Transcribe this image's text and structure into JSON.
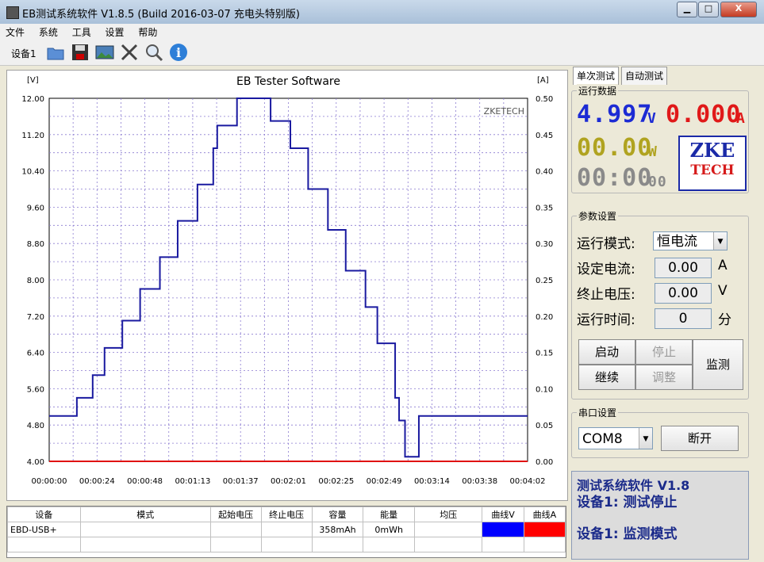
{
  "window": {
    "title": "EB测试系统软件 V1.8.5 (Build 2016-03-07 充电头特别版)",
    "min_label": "▁",
    "max_label": "□",
    "close_label": "X"
  },
  "menu": [
    "文件",
    "系统",
    "工具",
    "设置",
    "帮助"
  ],
  "toolbar": {
    "device_label": "设备1",
    "icons": [
      "folder-icon",
      "save-icon",
      "image-icon",
      "tools-icon",
      "magnifier-icon",
      "info-icon"
    ]
  },
  "chart_data": {
    "type": "line",
    "title": "EB Tester Software",
    "watermark": "ZKETECH",
    "ylabel": "[V]",
    "y2label": "[A]",
    "ylim": [
      4.0,
      12.0
    ],
    "y2lim": [
      0.0,
      0.5
    ],
    "yticks": [
      "12.00",
      "11.20",
      "10.40",
      "9.60",
      "8.80",
      "8.00",
      "7.20",
      "6.40",
      "5.60",
      "4.80",
      "4.00"
    ],
    "y2ticks": [
      "0.50",
      "0.45",
      "0.40",
      "0.35",
      "0.30",
      "0.25",
      "0.20",
      "0.15",
      "0.10",
      "0.05",
      "0.00"
    ],
    "xticks": [
      "00:00:00",
      "00:00:24",
      "00:00:48",
      "00:01:13",
      "00:01:37",
      "00:02:01",
      "00:02:25",
      "00:02:49",
      "00:03:14",
      "00:03:38",
      "00:04:02"
    ],
    "xlim_seconds": [
      0,
      242
    ],
    "series": [
      {
        "color": "#1a1aa0",
        "x": [
          0,
          12,
          14,
          22,
          28,
          37,
          46,
          56,
          65,
          75,
          83,
          85,
          95,
          103,
          108,
          112,
          122,
          131,
          141,
          150,
          160,
          166,
          175,
          177,
          180,
          187,
          200,
          212,
          242
        ],
        "y": [
          5.0,
          5.0,
          5.4,
          5.9,
          6.5,
          7.1,
          7.8,
          8.5,
          9.3,
          10.1,
          10.9,
          11.4,
          12.0,
          12.0,
          12.0,
          11.5,
          10.9,
          10.0,
          9.1,
          8.2,
          7.4,
          6.6,
          5.4,
          4.9,
          4.1,
          5.0,
          5.0,
          5.0,
          5.0
        ]
      },
      {
        "color": "#e01010",
        "x": [
          0,
          50,
          100,
          150,
          200,
          242
        ],
        "y": [
          4.0,
          4.0,
          4.0,
          4.0,
          4.0,
          4.0
        ]
      }
    ],
    "grid": true
  },
  "table": {
    "headers": [
      "设备",
      "模式",
      "起始电压",
      "终止电压",
      "容量",
      "能量",
      "均压",
      "曲线V",
      "曲线A"
    ],
    "row": [
      "EBD-USB+",
      "",
      "",
      "",
      "358mAh",
      "0mWh",
      "",
      "",
      ""
    ],
    "curve_colors": {
      "v": "#0000ff",
      "a": "#ff0000"
    }
  },
  "right": {
    "tabs": [
      "单次测试",
      "自动测试"
    ],
    "run_group": "运行数据",
    "voltage": "4.997",
    "voltage_unit": "V",
    "current": "0.000",
    "current_unit": "A",
    "power": "00.00",
    "power_unit": "W",
    "time": "00:00",
    "time_sub": "00",
    "logo_top": "ZKE",
    "logo_bottom": "TECH",
    "param_group": "参数设置",
    "mode_label": "运行模式:",
    "mode_value": "恒电流",
    "set_current_label": "设定电流:",
    "set_current_value": "0.00",
    "set_current_unit": "A",
    "end_voltage_label": "终止电压:",
    "end_voltage_value": "0.00",
    "end_voltage_unit": "V",
    "run_time_label": "运行时间:",
    "run_time_value": "0",
    "run_time_unit": "分",
    "buttons": {
      "start": "启动",
      "stop": "停止",
      "continue": "继续",
      "adjust": "调整",
      "monitor": "监测"
    },
    "serial_group": "串口设置",
    "port": "COM8",
    "disconnect": "断开",
    "status_lines": [
      "测试系统软件 V1.8",
      "设备1: 测试停止",
      "设备1: 监测模式"
    ],
    "colors": {
      "voltage": "#1c2bd4",
      "current": "#e01919",
      "power": "#b0a320",
      "time": "#8a8a8a"
    }
  }
}
